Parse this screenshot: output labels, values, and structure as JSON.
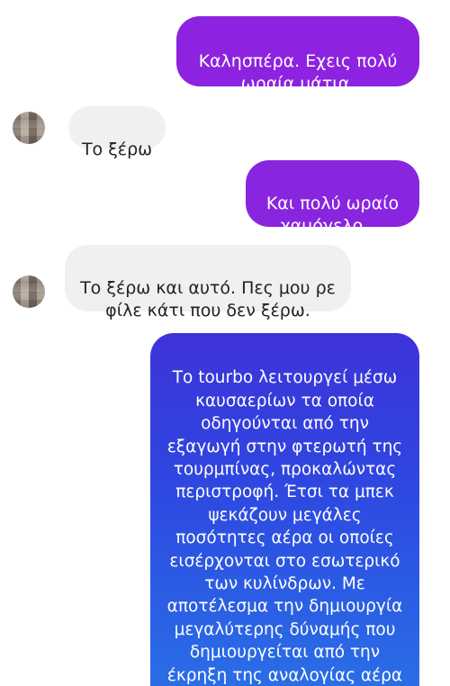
{
  "messages": [
    {
      "sender": "me",
      "text": "Καλησπέρα. Εχεις πολύ\nωραία μάτια."
    },
    {
      "sender": "them",
      "text": "Το ξέρω"
    },
    {
      "sender": "me",
      "text": "Και πολύ ωραίο\nχαμόγελο...."
    },
    {
      "sender": "them",
      "text": "Το ξέρω και αυτό. Πες μου ρε\nφίλε κάτι που δεν ξέρω."
    },
    {
      "sender": "me",
      "text": "Το tourbo λειτουργεί μέσω\nκαυσαερίων τα οποία\nοδηγούνται από την\nεξαγωγή στην φτερωτή της\nτουρμπίνας, προκαλώντας\nπεριστροφή. Έτσι τα μπεκ\nψεκάζουν μεγάλες\nποσότητες αέρα οι οποίες\nεισέρχονται στο εσωτερικό\nτων κυλίνδρων. Με\nαποτέλεσμα την δημιουργία\nμεγαλύτερης δύναμής που\nδημιουργείται από την\nέκρηξη της αναλογίας αέρα"
    }
  ],
  "colors": {
    "sent_purple": "#8d22e0",
    "sent_blue_top": "#3d33d9",
    "sent_blue_bottom": "#2a6fe6",
    "received_bg": "#f0f0f0"
  }
}
